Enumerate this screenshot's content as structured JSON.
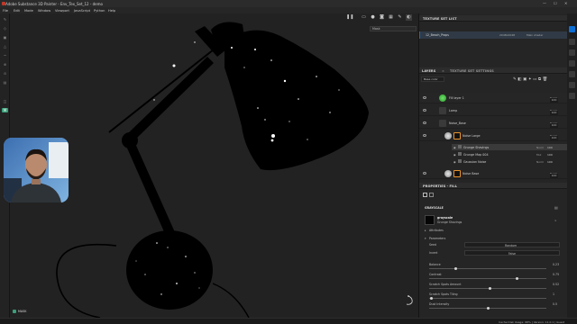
{
  "window": {
    "title": "Adobe Substance 3D Painter - Env_Tex_Set_12 - demo",
    "controls": [
      "—",
      "☐",
      "✕"
    ]
  },
  "menu": [
    "File",
    "Edit",
    "Mode",
    "Window",
    "Viewport",
    "JavaScript",
    "Python",
    "Help"
  ],
  "viewport": {
    "mode_select": "Mask",
    "bottom_label": "MASK"
  },
  "texture_set_list": {
    "header": "TEXTURE SET LIST",
    "item_name": "12_Beach_Props",
    "item_size": "2048x2048",
    "item_shader": "Main shader"
  },
  "layers": {
    "tabs": [
      "LAYERS",
      "TEXTURE SET SETTINGS"
    ],
    "channel_select": "Base color",
    "rows": [
      {
        "name": "Fill layer 1",
        "blend": "Norm",
        "opacity": "100"
      },
      {
        "name": "Lamp",
        "blend": "Norm",
        "opacity": "100"
      },
      {
        "name": "Noise_Base",
        "blend": "Norm",
        "opacity": "100"
      },
      {
        "name": "Noise Large",
        "blend": "Norm",
        "opacity": "100"
      },
      {
        "name": "Noise Base",
        "blend": "Norm",
        "opacity": "100"
      }
    ],
    "effects": [
      {
        "name": "Grunge Shavings",
        "blend": "Norm",
        "opacity": "100"
      },
      {
        "name": "Grunge Map 004",
        "blend": "Mul",
        "opacity": "100"
      },
      {
        "name": "Gaussian Noise",
        "blend": "Norm",
        "opacity": "100"
      }
    ]
  },
  "properties": {
    "header": "PROPERTIES - FILL",
    "section": "GRAYSCALE",
    "resource_type": "grayscale",
    "resource_name": "Grunge Shavings",
    "attributes_label": "Attributes",
    "parameters_label": "Parameters",
    "seed_label": "Seed",
    "seed_value": "Random",
    "invert_label": "Invert",
    "invert_value": "False",
    "params": [
      {
        "label": "Balance",
        "value": "0.23",
        "fraction": 0.23
      },
      {
        "label": "Contrast",
        "value": "0.75",
        "fraction": 0.75
      },
      {
        "label": "Scratch Spots Amount",
        "value": "0.52",
        "fraction": 0.52
      },
      {
        "label": "Scratch Spots Tiling",
        "value": "1",
        "fraction": 0.02
      },
      {
        "label": "Dust Intensity",
        "value": "0.5",
        "fraction": 0.5
      }
    ]
  },
  "status": {
    "text": "Cache Disk Usage: 98% | Version: 11.0.1 | Guest"
  },
  "colors": {
    "accent": "#0d6fd4",
    "highlight": "#e8922d",
    "panel": "#252525"
  }
}
